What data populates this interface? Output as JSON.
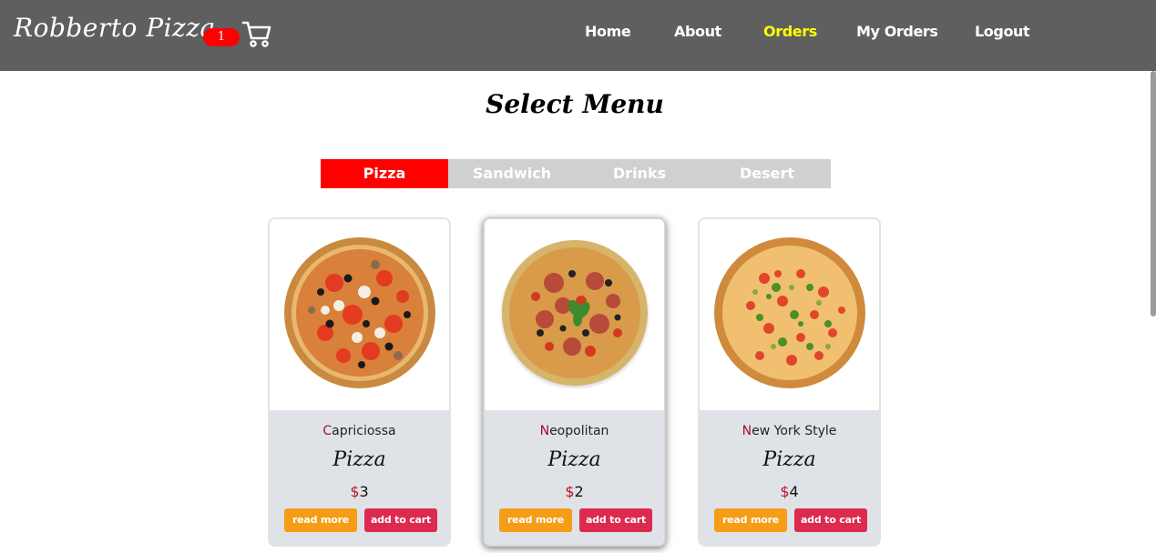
{
  "brand": "Robberto Pizza",
  "cart": {
    "count": "1",
    "icon": "cart-icon"
  },
  "nav": {
    "items": [
      {
        "label": "Home"
      },
      {
        "label": "About"
      },
      {
        "label": "Orders",
        "active": true
      },
      {
        "label": "My Orders"
      },
      {
        "label": "Logout"
      }
    ]
  },
  "page_title": "Select Menu",
  "tabs": [
    {
      "label": "Pizza",
      "active": true
    },
    {
      "label": "Sandwich"
    },
    {
      "label": "Drinks"
    },
    {
      "label": "Desert"
    }
  ],
  "cards": [
    {
      "name_first": "C",
      "name_rest": "apriciossa",
      "category": "Pizza",
      "currency": "$",
      "price": "3",
      "read_more": "read more",
      "add_to_cart": "add to cart",
      "image": "pizza-image"
    },
    {
      "name_first": "N",
      "name_rest": "eopolitan",
      "category": "Pizza",
      "currency": "$",
      "price": "2",
      "read_more": "read more",
      "add_to_cart": "add to cart",
      "image": "pizza-image"
    },
    {
      "name_first": "N",
      "name_rest": "ew York Style",
      "category": "Pizza",
      "currency": "$",
      "price": "4",
      "read_more": "read more",
      "add_to_cart": "add to cart",
      "image": "pizza-image"
    }
  ],
  "colors": {
    "navbar": "#5f5f5f",
    "active_nav": "#ffff00",
    "badge": "#ff0000",
    "active_tab": "#ff0000",
    "tab_bg": "#d0d0d0",
    "read_more": "#f59d16",
    "add_to_cart": "#dc2b4e",
    "card_body": "#dfe3e8"
  }
}
